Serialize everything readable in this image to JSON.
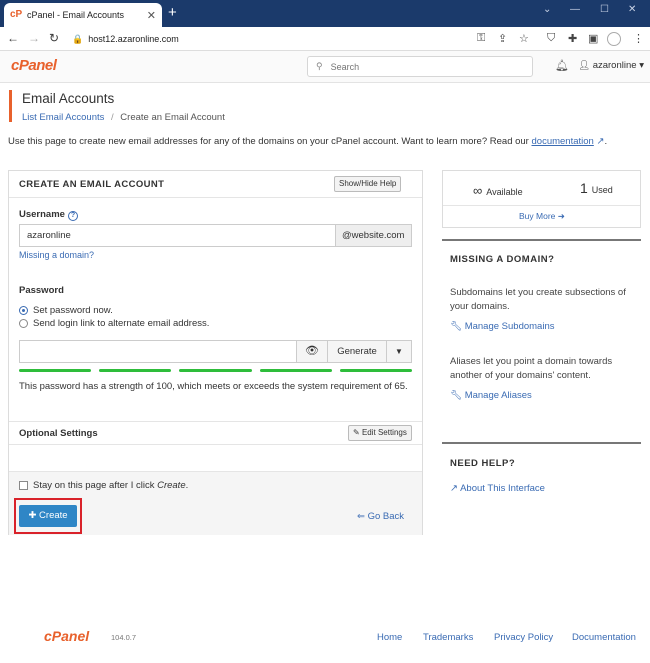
{
  "browser": {
    "tab_title": "cPanel - Email Accounts",
    "url": "host12.azaronline.com"
  },
  "header": {
    "logo": "cPanel",
    "search_placeholder": "Search",
    "username": "azaronline"
  },
  "page": {
    "title": "Email Accounts",
    "breadcrumb_parent": "List Email Accounts",
    "breadcrumb_sep": "/",
    "breadcrumb_current": "Create an Email Account",
    "intro": "Use this page to create new email addresses for any of the domains on your cPanel account. Want to learn more? Read our",
    "intro_link": "documentation",
    "intro_end": "."
  },
  "form": {
    "title": "CREATE AN EMAIL ACCOUNT",
    "show_hide_help": "Show/Hide Help",
    "username_label": "Username",
    "username_value": "azaronline",
    "domain_addon": "@website.com",
    "missing_domain_link": "Missing a domain?",
    "password_label": "Password",
    "radio_set_password": "Set password now.",
    "radio_send_link": "Send login link to alternate email address.",
    "generate_label": "Generate",
    "strength_text": "This password has a strength of 100, which meets or exceeds the system requirement of 65.",
    "optional_settings": "Optional Settings",
    "edit_settings": "Edit Settings",
    "stay_on_page_prefix": "Stay on this page after I click ",
    "stay_on_page_em": "Create",
    "stay_on_page_suffix": ".",
    "create_label": "Create",
    "go_back_label": "Go Back"
  },
  "sidebar": {
    "available_value": "∞",
    "available_label": "Available",
    "used_value": "1",
    "used_label": "Used",
    "buy_more": "Buy More",
    "missing_domain_heading": "MISSING A DOMAIN?",
    "subdomains_text": "Subdomains let you create subsections of your domains.",
    "manage_subdomains": "Manage Subdomains",
    "aliases_text": "Aliases let you point a domain towards another of your domains' content.",
    "manage_aliases": "Manage Aliases",
    "need_help_heading": "NEED HELP?",
    "about_interface": "About This Interface"
  },
  "footer": {
    "logo": "cPanel",
    "version": "104.0.7",
    "links": [
      "Home",
      "Trademarks",
      "Privacy Policy",
      "Documentation"
    ]
  },
  "colors": {
    "brand": "#e8612c",
    "link": "#3a6bb3",
    "primary_button": "#2f86c6",
    "strength_bar": "#2ebd3b",
    "highlight_box": "#d9222a"
  }
}
